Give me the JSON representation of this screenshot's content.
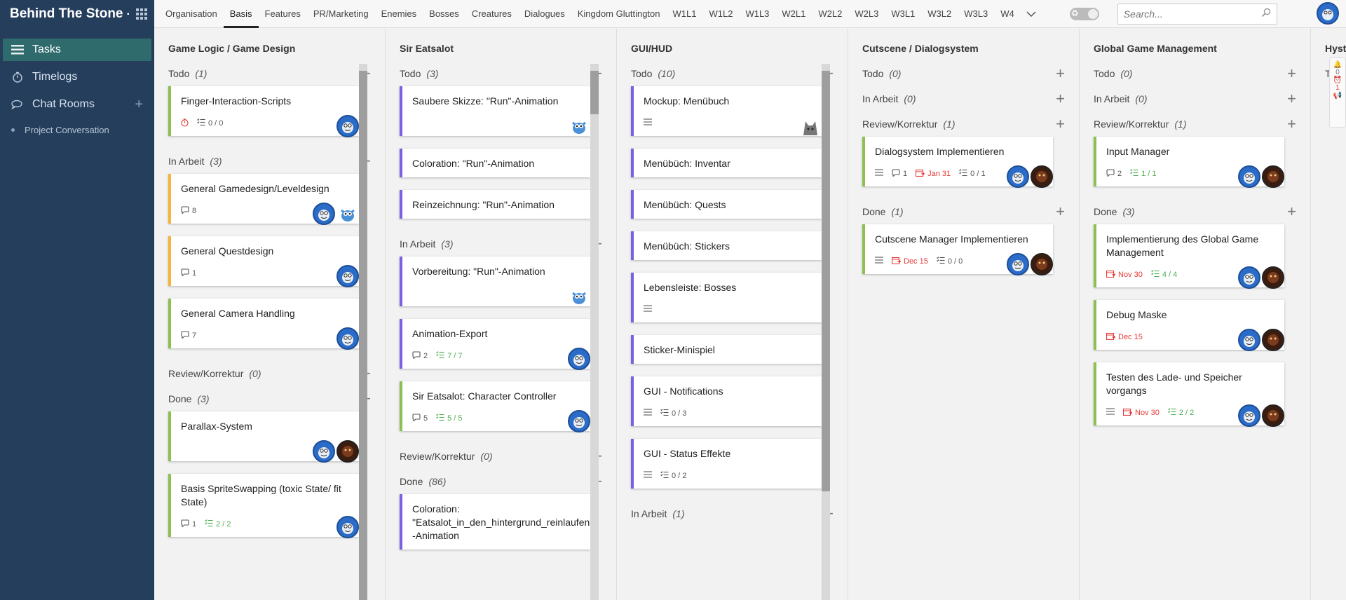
{
  "app": {
    "title": "Behind The Stone - ..."
  },
  "sidebar": {
    "items": [
      {
        "label": "Tasks",
        "icon": "list-icon"
      },
      {
        "label": "Timelogs",
        "icon": "stopwatch-icon"
      },
      {
        "label": "Chat Rooms",
        "icon": "chat-icon"
      }
    ],
    "sub_items": [
      {
        "label": "Project Conversation"
      }
    ]
  },
  "topbar": {
    "tabs": [
      "Organisation",
      "Basis",
      "Features",
      "PR/Marketing",
      "Enemies",
      "Bosses",
      "Creatures",
      "Dialogues",
      "Kingdom Gluttington",
      "W1L1",
      "W1L2",
      "W1L3",
      "W2L1",
      "W2L2",
      "W2L3",
      "W3L1",
      "W3L2",
      "W3L3",
      "W4"
    ],
    "active_tab": "Basis",
    "search_placeholder": "Search..."
  },
  "side_strip": {
    "badge1": "0",
    "badge2": "1"
  },
  "columns": [
    {
      "title": "Game Logic / Game Design",
      "groups": [
        {
          "name": "Todo",
          "count": "(1)",
          "cards": [
            {
              "title": "Finger-Interaction-Scripts",
              "color": "green",
              "meta": {
                "timer": true,
                "checklist": "0 / 0"
              },
              "avatars": [
                "blue"
              ]
            }
          ]
        },
        {
          "name": "In Arbeit",
          "count": "(3)",
          "cards": [
            {
              "title": "General Gamedesign/Leveldesign",
              "color": "orange",
              "meta": {
                "comments": "8"
              },
              "avatars": [
                "blue",
                "mascot"
              ]
            },
            {
              "title": "General Questdesign",
              "color": "orange",
              "meta": {
                "comments": "1"
              },
              "avatars": [
                "blue"
              ]
            },
            {
              "title": "General Camera Handling",
              "color": "green",
              "meta": {
                "comments": "7"
              },
              "avatars": [
                "blue"
              ]
            }
          ]
        },
        {
          "name": "Review/Korrektur",
          "count": "(0)",
          "cards": []
        },
        {
          "name": "Done",
          "count": "(3)",
          "cards": [
            {
              "title": "Parallax-System",
              "color": "green",
              "meta": {},
              "avatars": [
                "blue",
                "dark"
              ],
              "tall": true
            },
            {
              "title": "Basis SpriteSwapping (toxic State/ fit State)",
              "color": "green",
              "meta": {
                "comments": "1",
                "checklist": "2 / 2",
                "check_green": true
              },
              "avatars": [
                "blue"
              ]
            }
          ]
        }
      ]
    },
    {
      "title": "Sir Eatsalot",
      "groups": [
        {
          "name": "Todo",
          "count": "(3)",
          "cards": [
            {
              "title": "Saubere Skizze: \"Run\"-Animation",
              "color": "purple",
              "meta": {},
              "avatars": [
                "mascot"
              ],
              "tall": true
            },
            {
              "title": "Coloration: \"Run\"-Animation",
              "color": "purple",
              "meta": null,
              "avatars": []
            },
            {
              "title": "Reinzeichnung: \"Run\"-Animation",
              "color": "purple",
              "meta": null,
              "avatars": []
            }
          ]
        },
        {
          "name": "In Arbeit",
          "count": "(3)",
          "cards": [
            {
              "title": "Vorbereitung: \"Run\"-Animation",
              "color": "purple",
              "meta": {},
              "avatars": [
                "mascot"
              ],
              "tall": true
            },
            {
              "title": "Animation-Export",
              "color": "purple",
              "meta": {
                "comments": "2",
                "checklist": "7 / 7",
                "check_green": true
              },
              "avatars": [
                "blue"
              ]
            },
            {
              "title": "Sir Eatsalot: Character Controller",
              "color": "green",
              "meta": {
                "comments": "5",
                "checklist": "5 / 5",
                "check_green": true
              },
              "avatars": [
                "blue"
              ]
            }
          ]
        },
        {
          "name": "Review/Korrektur",
          "count": "(0)",
          "cards": []
        },
        {
          "name": "Done",
          "count": "(86)",
          "cards": [
            {
              "title": "Coloration: \"Eatsalot_in_den_hintergrund_reinlaufen\" -Animation",
              "color": "purple",
              "meta": null,
              "avatars": []
            }
          ]
        }
      ]
    },
    {
      "title": "GUI/HUD",
      "groups": [
        {
          "name": "Todo",
          "count": "(10)",
          "cards": [
            {
              "title": "Mockup: Menübuch",
              "color": "purple",
              "meta": {
                "desc": true
              },
              "avatars": [
                "wolf"
              ]
            },
            {
              "title": "Menübüch: Inventar",
              "color": "purple",
              "meta": null,
              "avatars": []
            },
            {
              "title": "Menübüch: Quests",
              "color": "purple",
              "meta": null,
              "avatars": []
            },
            {
              "title": "Menübüch: Stickers",
              "color": "purple",
              "meta": null,
              "avatars": []
            },
            {
              "title": "Lebensleiste: Bosses",
              "color": "purple",
              "meta": {
                "desc": true
              },
              "avatars": []
            },
            {
              "title": "Sticker-Minispiel",
              "color": "purple",
              "meta": null,
              "avatars": []
            },
            {
              "title": "GUI - Notifications",
              "color": "purple",
              "meta": {
                "desc": true,
                "checklist": "0 / 3"
              },
              "avatars": []
            },
            {
              "title": "GUI - Status Effekte",
              "color": "purple",
              "meta": {
                "desc": true,
                "checklist": "0 / 2"
              },
              "avatars": []
            }
          ]
        },
        {
          "name": "In Arbeit",
          "count": "(1)",
          "cards": []
        }
      ]
    },
    {
      "title": "Cutscene / Dialogsystem",
      "groups": [
        {
          "name": "Todo",
          "count": "(0)",
          "cards": []
        },
        {
          "name": "In Arbeit",
          "count": "(0)",
          "cards": []
        },
        {
          "name": "Review/Korrektur",
          "count": "(1)",
          "cards": [
            {
              "title": "Dialogsystem Implementieren",
              "color": "green",
              "meta": {
                "desc": true,
                "comments": "1",
                "date": "Jan 31",
                "checklist": "0 / 1"
              },
              "avatars": [
                "blue",
                "dark"
              ]
            }
          ]
        },
        {
          "name": "Done",
          "count": "(1)",
          "cards": [
            {
              "title": "Cutscene Manager Implementieren",
              "color": "green",
              "meta": {
                "desc": true,
                "date": "Dec 15",
                "checklist": "0 / 0"
              },
              "avatars": [
                "blue",
                "dark"
              ]
            }
          ]
        }
      ]
    },
    {
      "title": "Global Game Management",
      "groups": [
        {
          "name": "Todo",
          "count": "(0)",
          "cards": []
        },
        {
          "name": "In Arbeit",
          "count": "(0)",
          "cards": []
        },
        {
          "name": "Review/Korrektur",
          "count": "(1)",
          "cards": [
            {
              "title": "Input Manager",
              "color": "green",
              "meta": {
                "comments": "2",
                "checklist": "1 / 1",
                "check_green": true
              },
              "avatars": [
                "blue",
                "dark"
              ]
            }
          ]
        },
        {
          "name": "Done",
          "count": "(3)",
          "cards": [
            {
              "title": "Implementierung des Global Game Management",
              "color": "green",
              "meta": {
                "date": "Nov 30",
                "checklist": "4 / 4",
                "check_green": true
              },
              "avatars": [
                "blue",
                "dark"
              ]
            },
            {
              "title": "Debug Maske",
              "color": "green",
              "meta": {
                "date": "Dec 15"
              },
              "avatars": [
                "blue",
                "dark"
              ]
            },
            {
              "title": "Testen des Lade- und Speicher vorgangs",
              "color": "green",
              "meta": {
                "desc": true,
                "date": "Nov 30",
                "checklist": "2 / 2",
                "check_green": true
              },
              "avatars": [
                "blue",
                "dark"
              ]
            }
          ]
        }
      ]
    },
    {
      "title": "Hyst",
      "groups": [
        {
          "name": "T",
          "count": "",
          "cards": []
        }
      ]
    }
  ]
}
